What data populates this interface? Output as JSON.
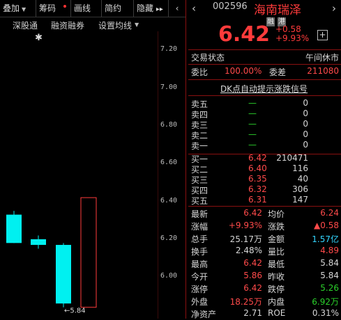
{
  "toolbar": {
    "overlay": "叠加",
    "chips": "筹码",
    "draw": "画线",
    "simple": "简约",
    "hide": "隐藏",
    "more": "▸▸"
  },
  "subbar": {
    "sgt": "深股通",
    "margin": "融资融券",
    "ma_settings": "设置均线"
  },
  "y_axis": [
    "7.20",
    "7.00",
    "6.80",
    "6.60",
    "6.40",
    "6.20",
    "6.00"
  ],
  "chart_data": {
    "type": "candlestick",
    "candles": [
      {
        "open": 6.18,
        "close": 6.33,
        "high": 6.35,
        "low": 6.18,
        "color": "cyan"
      },
      {
        "open": 6.2,
        "close": 6.17,
        "high": 6.22,
        "low": 6.15,
        "color": "cyan"
      },
      {
        "open": 6.17,
        "close": 5.86,
        "high": 6.18,
        "low": 5.84,
        "color": "cyan"
      },
      {
        "open": 5.84,
        "close": 6.42,
        "high": 6.42,
        "low": 5.84,
        "color": "red-hollow"
      }
    ],
    "low_annotation": "5.84",
    "ylim": [
      5.78,
      7.3
    ]
  },
  "quote": {
    "code": "002596",
    "name": "海南瑞泽",
    "badge1": "融",
    "badge2": "港",
    "price": "6.42",
    "change": "+0.58",
    "change_pct": "+9.93%"
  },
  "status": {
    "label": "交易状态",
    "value": "午间休市"
  },
  "weibi": {
    "label1": "委比",
    "value1": "100.00%",
    "label2": "委差",
    "value2": "211080"
  },
  "dk_link": "DK点自动提示涨跌信号",
  "sells": [
    {
      "label": "卖五",
      "price": "—",
      "vol": "0"
    },
    {
      "label": "卖四",
      "price": "—",
      "vol": "0"
    },
    {
      "label": "卖三",
      "price": "—",
      "vol": "0"
    },
    {
      "label": "卖二",
      "price": "—",
      "vol": "0"
    },
    {
      "label": "卖一",
      "price": "—",
      "vol": "0"
    }
  ],
  "buys": [
    {
      "label": "买一",
      "price": "6.42",
      "vol": "210471"
    },
    {
      "label": "买二",
      "price": "6.40",
      "vol": "116"
    },
    {
      "label": "买三",
      "price": "6.35",
      "vol": "40"
    },
    {
      "label": "买四",
      "price": "6.32",
      "vol": "306"
    },
    {
      "label": "买五",
      "price": "6.31",
      "vol": "147"
    }
  ],
  "stats": [
    {
      "l1": "最新",
      "v1": "6.42",
      "c1": "r",
      "l2": "均价",
      "v2": "6.24",
      "c2": "r"
    },
    {
      "l1": "涨幅",
      "v1": "+9.93%",
      "c1": "r",
      "l2": "涨跌",
      "v2": "▲0.58",
      "c2": "r"
    },
    {
      "l1": "总手",
      "v1": "25.17万",
      "c1": "w",
      "l2": "金额",
      "v2": "1.57亿",
      "c2": "c"
    },
    {
      "l1": "换手",
      "v1": "2.48%",
      "c1": "w",
      "l2": "量比",
      "v2": "4.89",
      "c2": "r"
    },
    {
      "l1": "最高",
      "v1": "6.42",
      "c1": "r",
      "l2": "最低",
      "v2": "5.84",
      "c2": "w"
    },
    {
      "l1": "今开",
      "v1": "5.86",
      "c1": "r",
      "l2": "昨收",
      "v2": "5.84",
      "c2": "w"
    },
    {
      "l1": "涨停",
      "v1": "6.42",
      "c1": "r",
      "l2": "跌停",
      "v2": "5.26",
      "c2": "g"
    },
    {
      "l1": "外盘",
      "v1": "18.25万",
      "c1": "r",
      "l2": "内盘",
      "v2": "6.92万",
      "c2": "g"
    },
    {
      "l1": "净资产",
      "v1": "2.71",
      "c1": "w",
      "l2": "ROE",
      "v2": "0.31%",
      "c2": "w"
    }
  ]
}
